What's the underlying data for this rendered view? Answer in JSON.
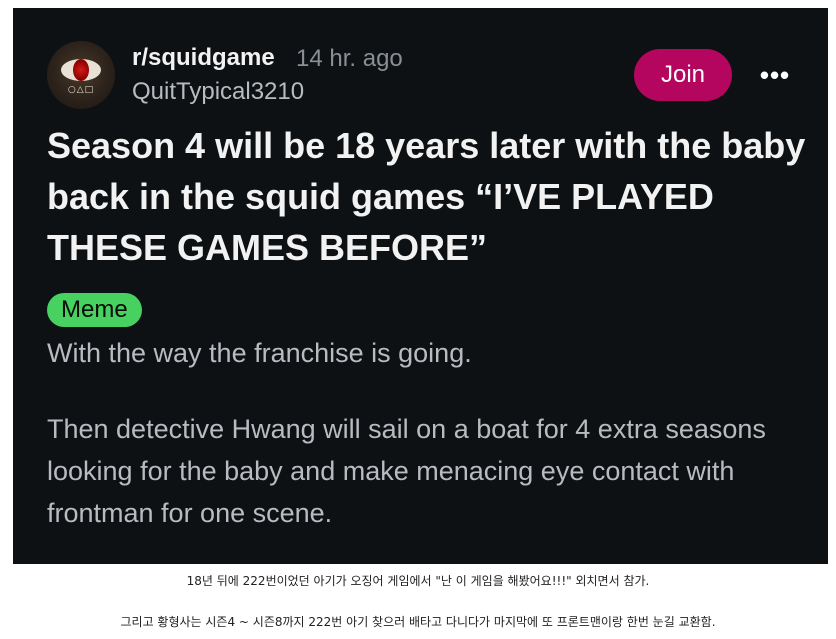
{
  "post": {
    "subreddit": "r/squidgame",
    "time": "14 hr. ago",
    "username": "QuitTypical3210",
    "join_label": "Join",
    "more_label": "•••",
    "avatar_shapes": "○△□",
    "title": "Season 4 will be 18 years later with the baby back in the squid games “I’VE PLAYED THESE GAMES BEFORE”",
    "flair": "Meme",
    "body_p1": "With the way the franchise is going.",
    "body_p2": "Then detective Hwang will sail on a boat for 4 extra seasons looking for the baby and make menacing eye contact with frontman for one scene."
  },
  "captions": {
    "line1": "18년 뒤에 222번이었던 아기가 오징어 게임에서 \"난 이 게임을 해봤어요!!!\" 외치면서 참가.",
    "line2": "그리고 황형사는 시즌4 ~ 시즌8까지 222번 아기 찾으러 배타고 다니다가 마지막에 또 프론트맨이랑 한번 눈길 교환함."
  },
  "colors": {
    "card_bg": "#0e1113",
    "join_bg": "#b5065f",
    "flair_bg": "#46d160"
  }
}
